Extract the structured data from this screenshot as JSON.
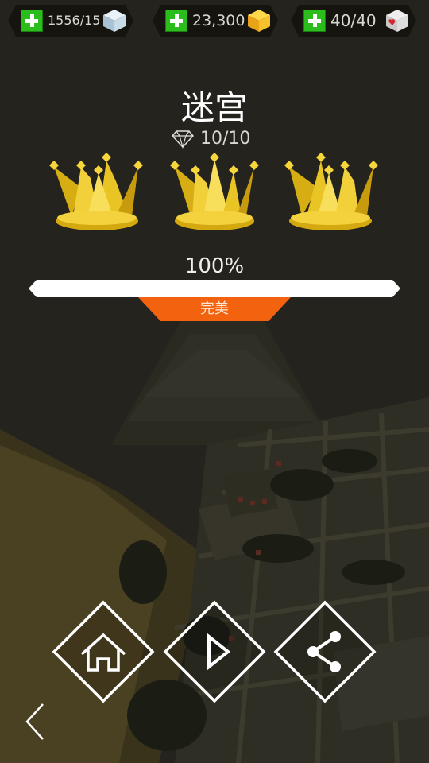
{
  "resources": [
    {
      "name": "cubes",
      "count": "1556/15",
      "icon": "ice-cube-icon"
    },
    {
      "name": "gems",
      "count": "23,300",
      "icon": "gold-gem-icon"
    },
    {
      "name": "lives",
      "count": "40/40",
      "icon": "heart-cube-icon"
    }
  ],
  "level": {
    "title": "迷宫",
    "gems": "10/10",
    "crowns_earned": 3,
    "crowns_total": 3,
    "progress_label": "100%",
    "progress_fraction": 1.0,
    "rank_label": "完美"
  },
  "actions": [
    {
      "name": "home-button",
      "icon": "home-icon"
    },
    {
      "name": "play-button",
      "icon": "play-icon"
    },
    {
      "name": "share-button",
      "icon": "share-icon"
    }
  ],
  "nav": {
    "back_icon": "chevron-left-icon"
  },
  "colors": {
    "accent_orange": "#f2620f",
    "plus_green": "#2bbd1c",
    "crown_gold": "#e8c22a",
    "background": "#24231d"
  }
}
